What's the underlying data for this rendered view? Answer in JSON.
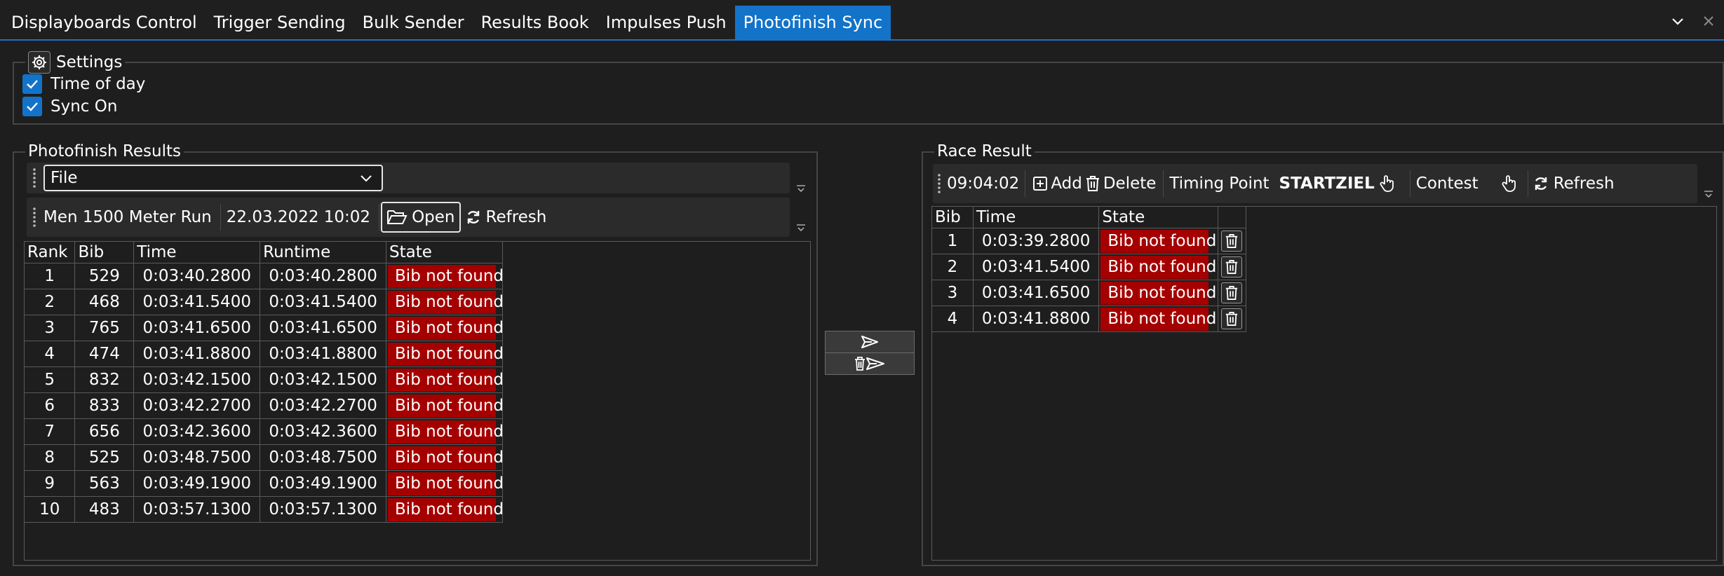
{
  "tabs": [
    {
      "label": "Displayboards Control",
      "active": false
    },
    {
      "label": "Trigger Sending",
      "active": false
    },
    {
      "label": "Bulk Sender",
      "active": false
    },
    {
      "label": "Results Book",
      "active": false
    },
    {
      "label": "Impulses Push",
      "active": false
    },
    {
      "label": "Photofinish Sync",
      "active": true
    }
  ],
  "window_icons": [
    "chevron-down-icon",
    "close-icon"
  ],
  "settings": {
    "title": "Settings",
    "icon": "gear-icon",
    "time_of_day": {
      "label": "Time of day",
      "checked": true
    },
    "sync_on": {
      "label": "Sync On",
      "checked": true
    }
  },
  "photofinish": {
    "title": "Photofinish Results",
    "source_select": "File",
    "race_name": "Men 1500 Meter Run",
    "race_datetime": "22.03.2022 10:02",
    "open_label": "Open",
    "refresh_label": "Refresh",
    "columns": [
      "Rank",
      "Bib",
      "Time",
      "Runtime",
      "State"
    ],
    "rows": [
      {
        "rank": "1",
        "bib": "529",
        "time": "0:03:40.2800",
        "runtime": "0:03:40.2800",
        "state": "Bib not found"
      },
      {
        "rank": "2",
        "bib": "468",
        "time": "0:03:41.5400",
        "runtime": "0:03:41.5400",
        "state": "Bib not found"
      },
      {
        "rank": "3",
        "bib": "765",
        "time": "0:03:41.6500",
        "runtime": "0:03:41.6500",
        "state": "Bib not found"
      },
      {
        "rank": "4",
        "bib": "474",
        "time": "0:03:41.8800",
        "runtime": "0:03:41.8800",
        "state": "Bib not found"
      },
      {
        "rank": "5",
        "bib": "832",
        "time": "0:03:42.1500",
        "runtime": "0:03:42.1500",
        "state": "Bib not found"
      },
      {
        "rank": "6",
        "bib": "833",
        "time": "0:03:42.2700",
        "runtime": "0:03:42.2700",
        "state": "Bib not found"
      },
      {
        "rank": "7",
        "bib": "656",
        "time": "0:03:42.3600",
        "runtime": "0:03:42.3600",
        "state": "Bib not found"
      },
      {
        "rank": "8",
        "bib": "525",
        "time": "0:03:48.7500",
        "runtime": "0:03:48.7500",
        "state": "Bib not found"
      },
      {
        "rank": "9",
        "bib": "563",
        "time": "0:03:49.1900",
        "runtime": "0:03:49.1900",
        "state": "Bib not found"
      },
      {
        "rank": "10",
        "bib": "483",
        "time": "0:03:57.1300",
        "runtime": "0:03:57.1300",
        "state": "Bib not found"
      }
    ]
  },
  "transfer_buttons": [
    "send-icon",
    "clear-and-send-icon"
  ],
  "race_result": {
    "title": "Race Result",
    "clock": "09:04:02",
    "add_label": "Add",
    "delete_label": "Delete",
    "timing_point_label": "Timing Point",
    "timing_point_value": "STARTZIEL",
    "contest_label": "Contest",
    "refresh_label": "Refresh",
    "columns": [
      "Bib",
      "Time",
      "State",
      ""
    ],
    "rows": [
      {
        "bib": "1",
        "time": "0:03:39.2800",
        "state": "Bib not found"
      },
      {
        "bib": "2",
        "time": "0:03:41.5400",
        "state": "Bib not found"
      },
      {
        "bib": "3",
        "time": "0:03:41.6500",
        "state": "Bib not found"
      },
      {
        "bib": "4",
        "time": "0:03:41.8800",
        "state": "Bib not found"
      }
    ]
  },
  "colors": {
    "accent": "#1273c9",
    "state_error": "#a50000",
    "background": "#1e1e1e"
  }
}
